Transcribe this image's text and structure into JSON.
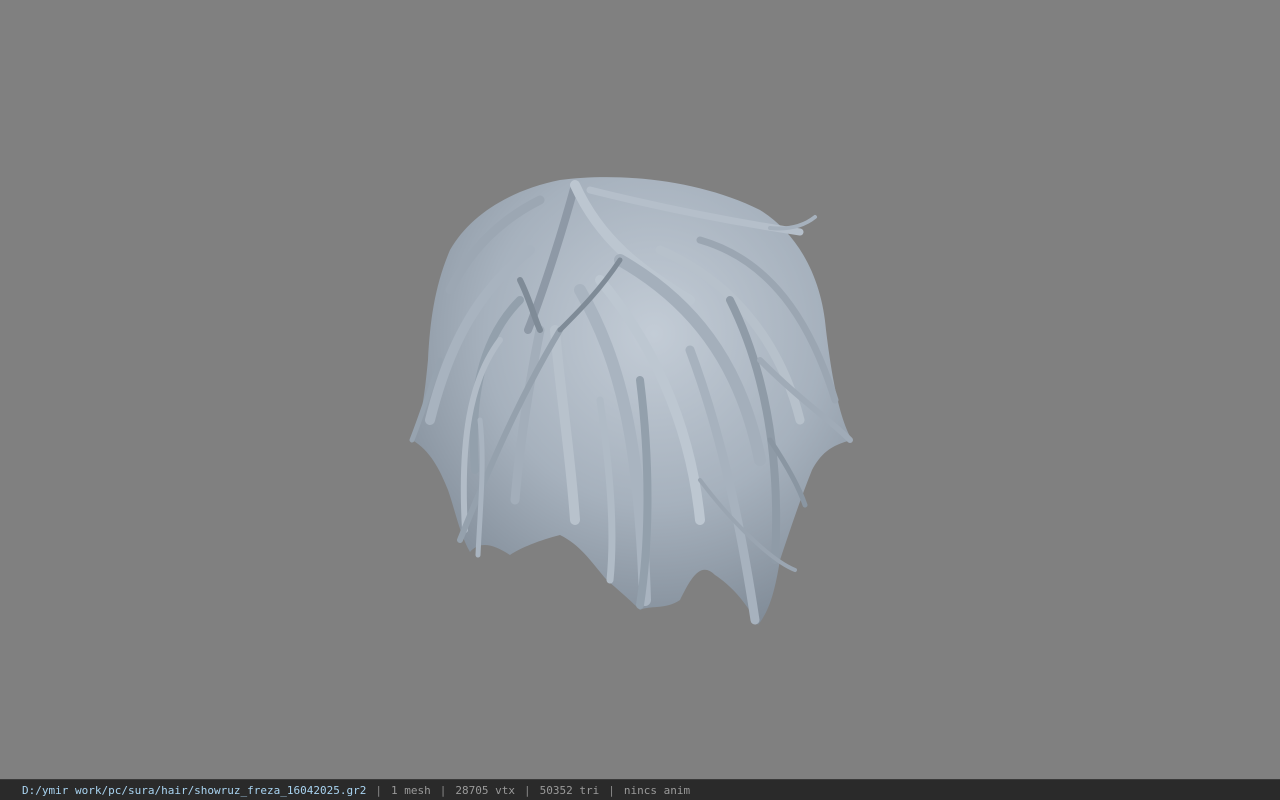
{
  "viewport": {
    "background": "#808080",
    "model_name": "hair mesh",
    "model_color": "#a9b4c0"
  },
  "status_bar": {
    "file_path": "D:/ymir work/pc/sura/hair/showruz_freza_16042025.gr2",
    "separator": "|",
    "mesh_count": "1 mesh",
    "vertex_count": "28705 vtx",
    "triangle_count": "50352 tri",
    "animation": "nincs anim"
  }
}
